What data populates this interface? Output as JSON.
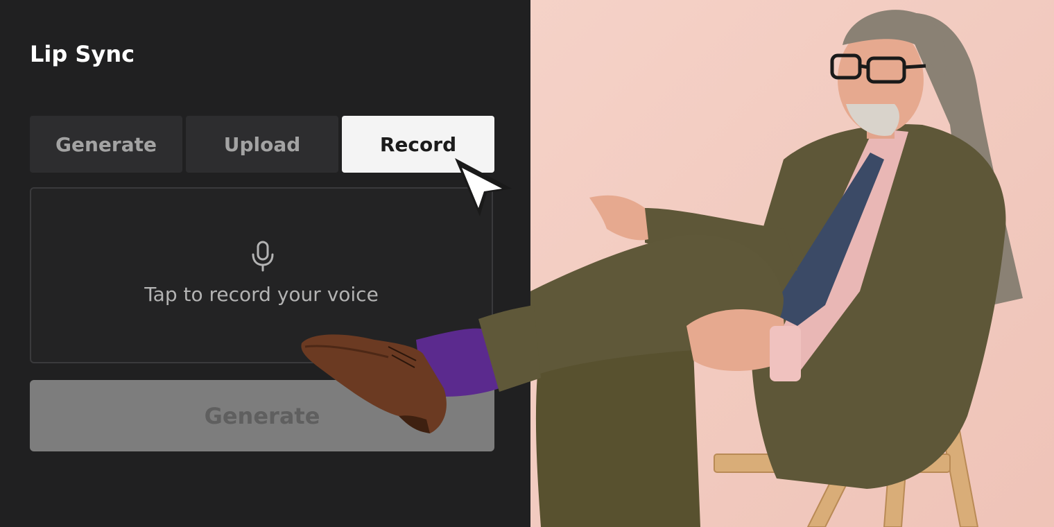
{
  "panel": {
    "title": "Lip Sync",
    "tabs": [
      {
        "label": "Generate",
        "active": false
      },
      {
        "label": "Upload",
        "active": false
      },
      {
        "label": "Record",
        "active": true
      }
    ],
    "record_area": {
      "icon": "microphone-icon",
      "label": "Tap to record your voice"
    },
    "generate_button": {
      "label": "Generate",
      "disabled": true
    }
  },
  "colors": {
    "panel_background": "#202021",
    "tab_background": "#2d2d2f",
    "tab_active_background": "#f4f4f4",
    "button_disabled_background": "#7d7d7d",
    "photo_background": "#f2c9bf",
    "suit": "#5e5738",
    "sock": "#5b2a8e",
    "shoe": "#6b3a22"
  },
  "cursor": {
    "icon": "mouse-pointer-icon"
  }
}
